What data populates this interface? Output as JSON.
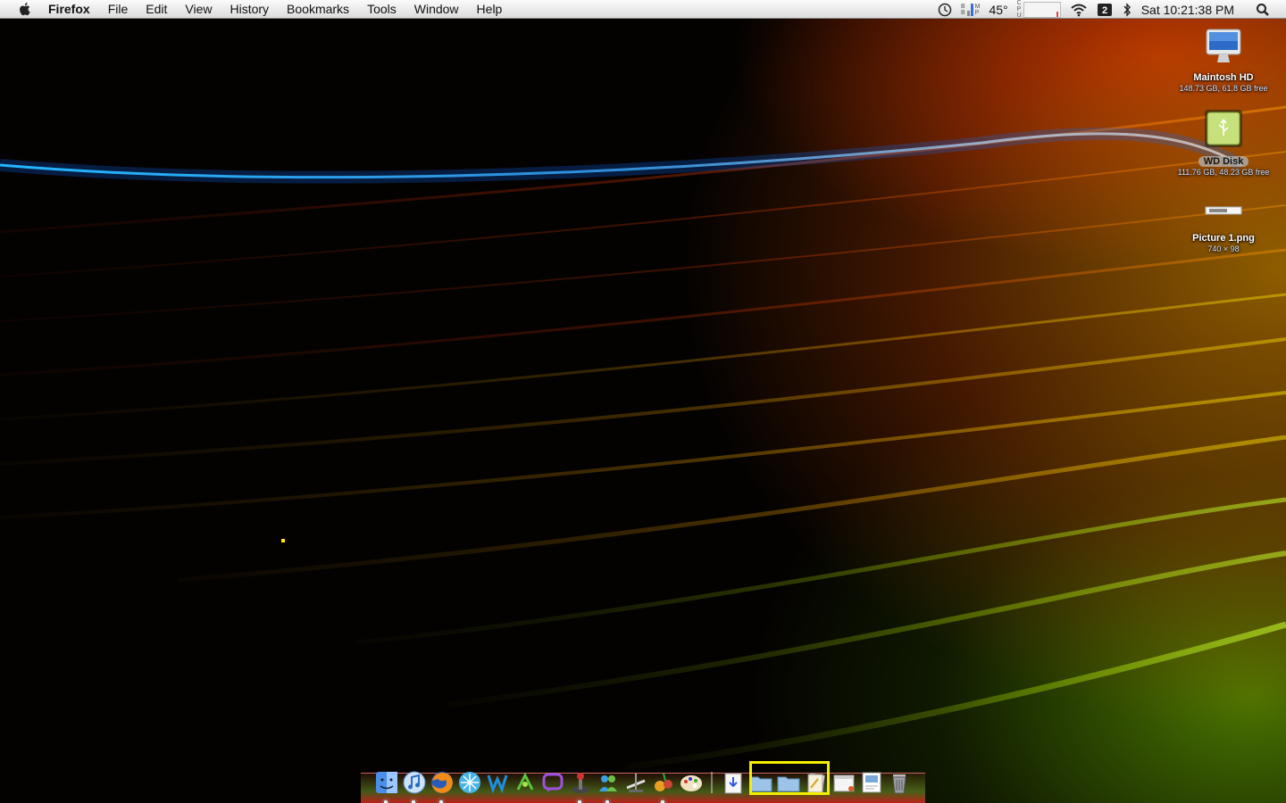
{
  "menubar": {
    "app_name": "Firefox",
    "items": [
      "File",
      "Edit",
      "View",
      "History",
      "Bookmarks",
      "Tools",
      "Window",
      "Help"
    ],
    "status": {
      "temperature": "45°",
      "clock": "Sat 10:21:38 PM",
      "icons": [
        "time-machine-icon",
        "battery-bar-icon",
        "memory-monitor-icon",
        "cpu-monitor-icon",
        "wifi-icon",
        "spaces-icon",
        "bluetooth-icon",
        "spotlight-icon"
      ],
      "mini_labels": [
        "B",
        "B",
        "M",
        "P",
        "C",
        "P",
        "U"
      ]
    }
  },
  "desktop": {
    "icons": [
      {
        "name": "Maintosh HD",
        "sub": "148.73 GB, 61.8 GB free",
        "icon": "imac-hard-drive-icon"
      },
      {
        "name": "WD Disk",
        "sub": "111.76 GB, 48.23 GB free",
        "icon": "usb-drive-icon"
      },
      {
        "name": "Picture 1.png",
        "sub": "740 × 98",
        "icon": "image-file-icon"
      }
    ]
  },
  "dock": {
    "apps": [
      "finder-icon",
      "itunes-icon",
      "firefox-icon",
      "network-utility-icon",
      "wordpress-icon",
      "game-icon",
      "chat-icon",
      "joystick-icon",
      "messenger-icon",
      "system-tool-icon",
      "fruit-game-icon",
      "paint-icon"
    ],
    "stacks": [
      "downloads-stack-icon",
      "folder-icon",
      "folder-icon",
      "documents-stack-icon",
      "browser-window-icon",
      "preview-icon",
      "trash-icon"
    ]
  },
  "colors": {
    "highlight": "#f3ef00",
    "menubar": "#e9e9e9",
    "accent_blue": "#22b6ff"
  }
}
